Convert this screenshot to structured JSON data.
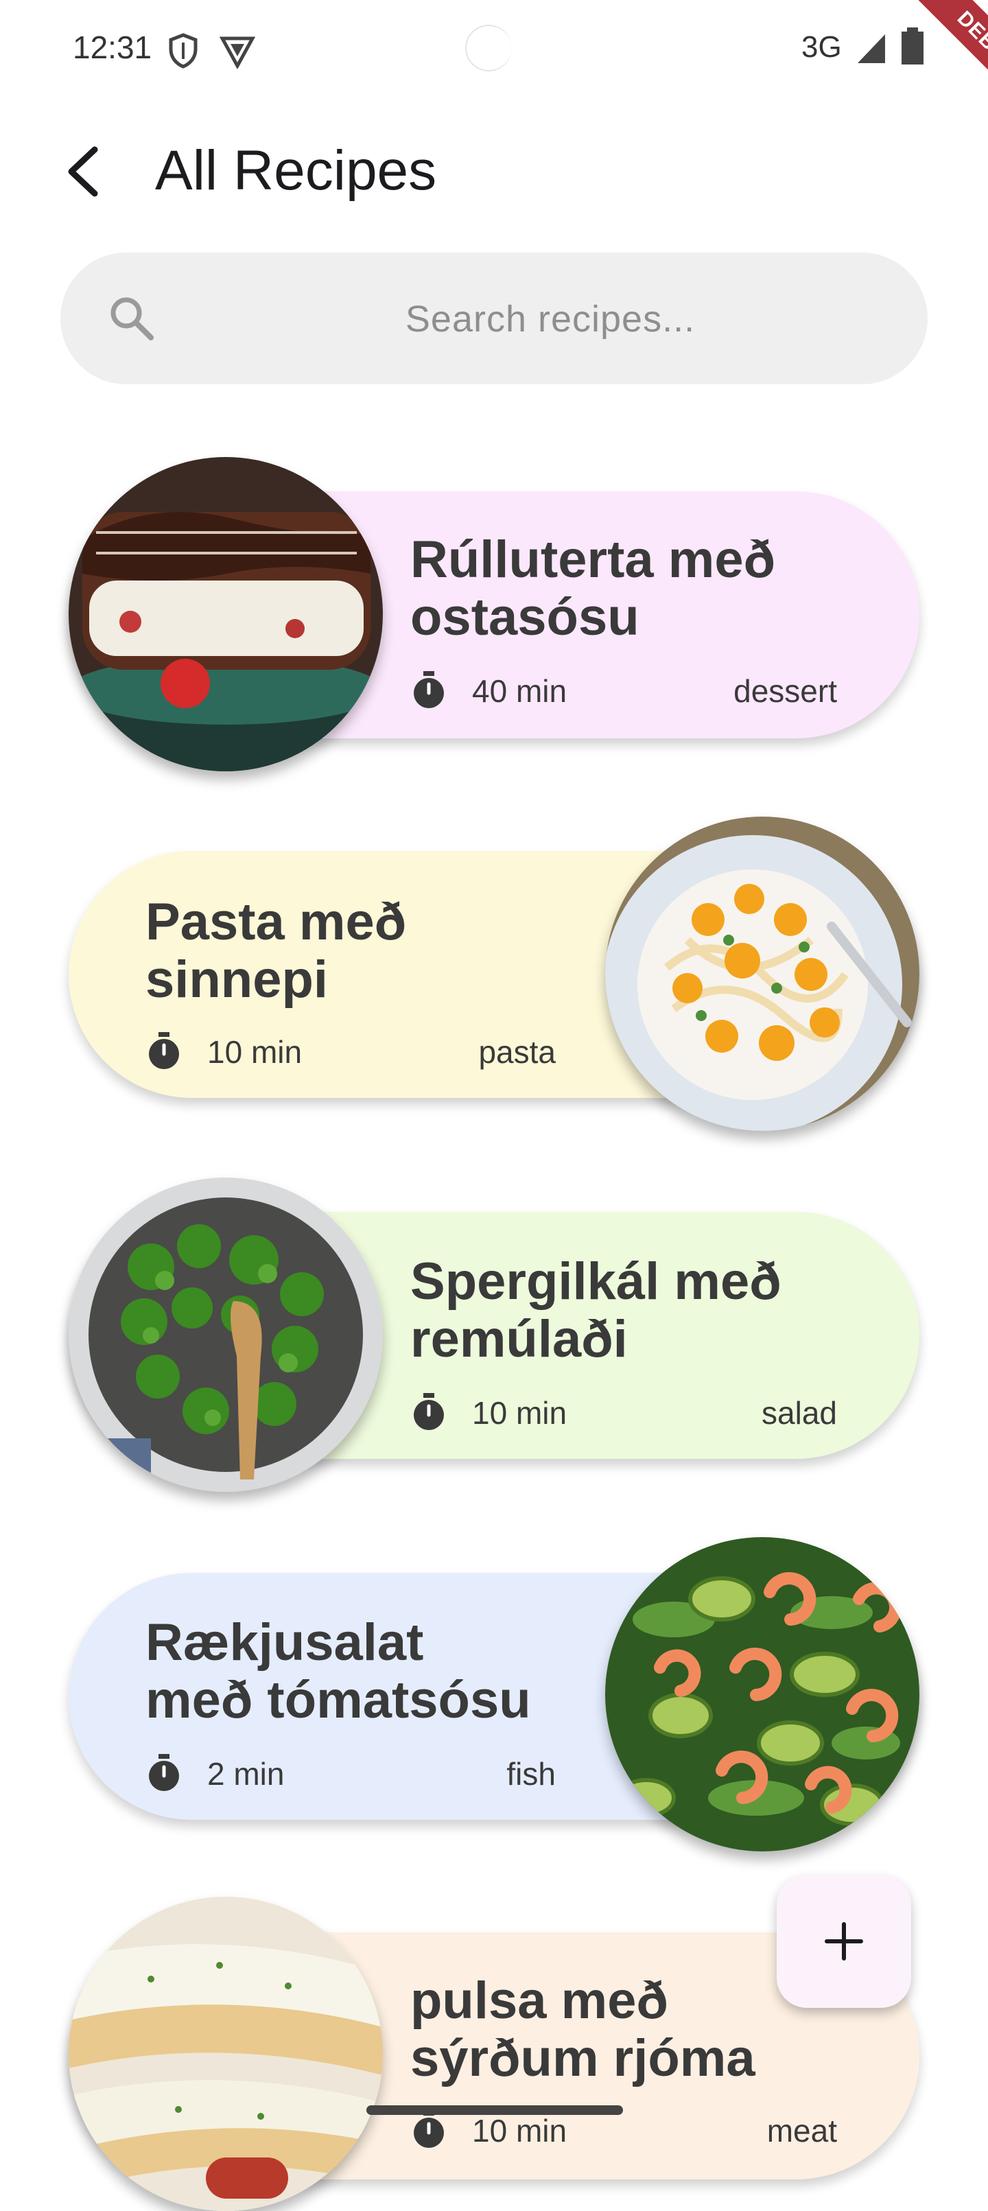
{
  "status_bar": {
    "time": "12:31",
    "network": "3G",
    "debug_label": "DEBUG"
  },
  "app_bar": {
    "title": "All Recipes"
  },
  "search": {
    "placeholder": "Search recipes..."
  },
  "recipes": [
    {
      "title_line1": "Rúlluterta með",
      "title_line2": "ostasósu",
      "time": "40 min",
      "category": "dessert",
      "card_color": "#fce8fc",
      "photo": "chocolate-cream-roll-cake"
    },
    {
      "title_line1": "Pasta með",
      "title_line2": "sinnepi",
      "time": "10 min",
      "category": "pasta",
      "card_color": "#fdf8d8",
      "photo": "pasta-with-cherry-tomatoes"
    },
    {
      "title_line1": "Spergilkál með",
      "title_line2": "remúlaði",
      "time": "10 min",
      "category": "salad",
      "card_color": "#edfadc",
      "photo": "broccoli-in-pan"
    },
    {
      "title_line1": "Rækjusalat",
      "title_line2": "með tómatsósu",
      "time": "2 min",
      "category": "fish",
      "card_color": "#e5edfd",
      "photo": "shrimp-avocado-salad"
    },
    {
      "title_line1": "pulsa með",
      "title_line2": "sýrðum rjóma",
      "time": "10 min",
      "category": "meat",
      "card_color": "#fdf0e2",
      "photo": "hot-dogs-with-sauce"
    }
  ],
  "fab": {
    "icon": "plus-icon"
  },
  "colors": {
    "search_bg": "#efefef",
    "title_text": "#3a3a3a",
    "debug_ribbon": "#b0323a"
  }
}
